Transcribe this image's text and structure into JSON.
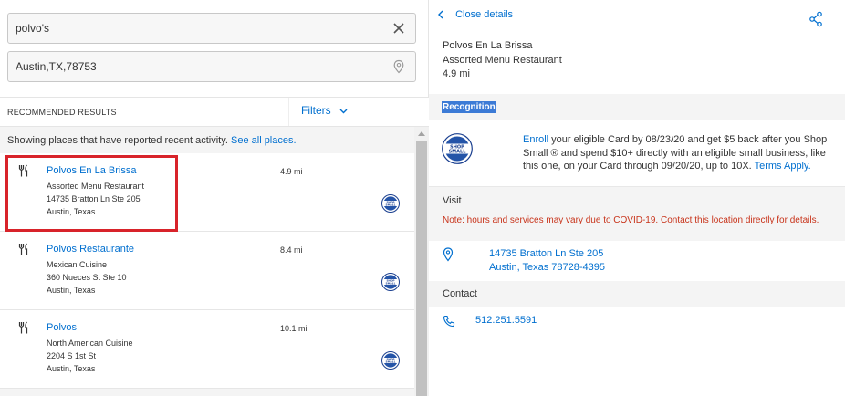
{
  "search": {
    "query_value": "polvo's",
    "location_value": "Austin,TX,78753"
  },
  "results_header": {
    "title": "RECOMMENDED RESULTS",
    "filters_label": "Filters"
  },
  "notice": {
    "text": "Showing places that have reported recent activity.",
    "link": "See all places."
  },
  "results": [
    {
      "name": "Polvos En La Brissa",
      "category": "Assorted Menu Restaurant",
      "street": "14735 Bratton Ln Ste 205",
      "city": "Austin, Texas",
      "distance": "4.9 mi"
    },
    {
      "name": "Polvos Restaurante",
      "category": "Mexican Cuisine",
      "street": "360 Nueces St Ste 10",
      "city": "Austin, Texas",
      "distance": "8.4 mi"
    },
    {
      "name": "Polvos",
      "category": "North American Cuisine",
      "street": "2204 S 1st St",
      "city": "Austin, Texas",
      "distance": "10.1 mi"
    }
  ],
  "badge": {
    "line1": "SHOP",
    "line2": "SMALL"
  },
  "details": {
    "close_label": "Close details",
    "name": "Polvos En La Brissa",
    "category": "Assorted Menu Restaurant",
    "distance": "4.9 mi",
    "recognition_label": "Recognition",
    "promo": {
      "enroll_link": "Enroll",
      "text": " your eligible Card by 08/23/20 and get $5 back after you Shop Small ® and spend $10+ directly with an eligible small business, like this one, on your Card through 09/20/20, up to 10X. ",
      "terms_link": "Terms Apply."
    },
    "visit_label": "Visit",
    "covid_note": "Note: hours and services may vary due to COVID-19. Contact this location directly for details.",
    "address_line1": "14735 Bratton Ln Ste 205",
    "address_line2": "Austin, Texas 78728-4395",
    "contact_label": "Contact",
    "phone": "512.251.5591"
  },
  "colors": {
    "link": "#006fcf",
    "highlight": "#d8232a",
    "note": "#c8331a",
    "selection": "#3c7bd6"
  }
}
